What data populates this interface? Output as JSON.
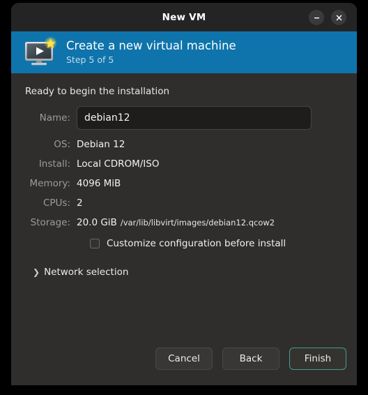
{
  "window": {
    "title": "New VM",
    "controls": [
      {
        "name": "minimize-button",
        "glyph": "minimize-icon"
      },
      {
        "name": "close-button",
        "glyph": "close-icon"
      }
    ]
  },
  "banner": {
    "icon": "virtual-machine-new-icon",
    "title": "Create a new virtual machine",
    "step": "Step 5 of 5",
    "background_color": "#0f74ab"
  },
  "body": {
    "heading": "Ready to begin the installation",
    "name_field": {
      "label": "Name:",
      "value": "debian12",
      "placeholder": ""
    },
    "summary_rows": [
      {
        "label": "OS:",
        "value": "Debian 12"
      },
      {
        "label": "Install:",
        "value": "Local CDROM/ISO"
      },
      {
        "label": "Memory:",
        "value": "4096 MiB"
      },
      {
        "label": "CPUs:",
        "value": "2"
      }
    ],
    "storage": {
      "label": "Storage:",
      "size": "20.0 GiB",
      "path": "/var/lib/libvirt/images/debian12.qcow2"
    },
    "customize": {
      "label": "Customize configuration before install",
      "checked": false
    },
    "network_expander": {
      "chevron": "chevron-right-icon",
      "label": "Network selection",
      "expanded": false
    }
  },
  "footer": {
    "cancel_label": "Cancel",
    "back_label": "Back",
    "finish_label": "Finish",
    "finish_accent_color": "#3f9e95"
  }
}
